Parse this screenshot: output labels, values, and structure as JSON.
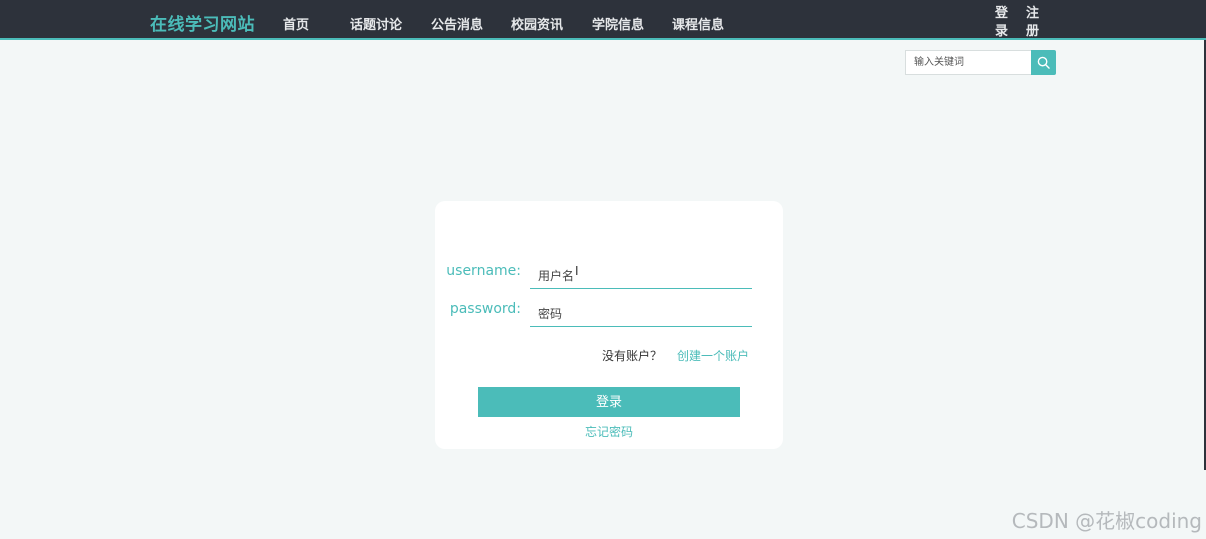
{
  "header": {
    "brand": "在线学习网站",
    "nav_items": [
      "首页",
      "话题讨论",
      "公告消息",
      "校园资讯",
      "学院信息",
      "课程信息"
    ],
    "login_label": "登录",
    "register_label": "注册"
  },
  "search": {
    "placeholder": "输入关键词",
    "icon": "search-icon"
  },
  "login_form": {
    "username_label": "username:",
    "username_placeholder": "用户名",
    "password_label": "password:",
    "password_placeholder": "密码",
    "no_account_text": "没有账户？",
    "create_account_link": "创建一个账户",
    "submit_label": "登录",
    "forgot_password_link": "忘记密码"
  },
  "watermark": "CSDN @花椒coding",
  "colors": {
    "accent": "#4bbcb9",
    "navbar_bg": "#2d323b",
    "page_bg": "#f3f7f7",
    "card_bg": "#ffffff"
  }
}
